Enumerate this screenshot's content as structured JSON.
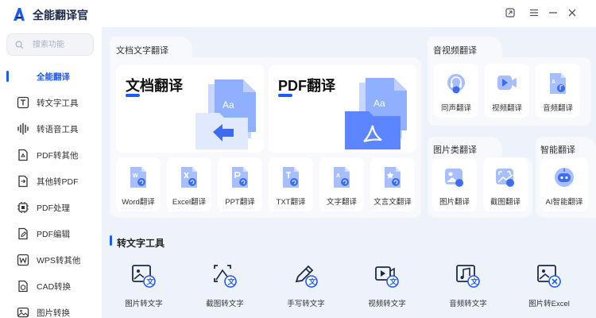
{
  "app": {
    "title": "全能翻译官"
  },
  "sidebar": {
    "search_placeholder": "搜索功能",
    "items": [
      {
        "label": "全能翻译",
        "active": true
      },
      {
        "label": "转文字工具"
      },
      {
        "label": "转语音工具"
      },
      {
        "label": "PDF转其他"
      },
      {
        "label": "其他转PDF"
      },
      {
        "label": "PDF处理"
      },
      {
        "label": "PDF编辑"
      },
      {
        "label": "WPS转其他"
      },
      {
        "label": "CAD转换"
      },
      {
        "label": "图片转换"
      }
    ]
  },
  "doc_section": {
    "title": "文档文字翻译",
    "big_cards": [
      {
        "label": "文档翻译"
      },
      {
        "label": "PDF翻译"
      }
    ],
    "cards": [
      {
        "label": "Word翻译"
      },
      {
        "label": "Excel翻译"
      },
      {
        "label": "PPT翻译"
      },
      {
        "label": "TXT翻译"
      },
      {
        "label": "文字翻译"
      },
      {
        "label": "文言文翻译"
      }
    ]
  },
  "av_section": {
    "title": "音视频翻译",
    "cards": [
      {
        "label": "同声翻译"
      },
      {
        "label": "视频翻译"
      },
      {
        "label": "音频翻译"
      }
    ]
  },
  "image_section": {
    "title": "图片类翻译",
    "cards": [
      {
        "label": "图片翻译"
      },
      {
        "label": "截图翻译"
      }
    ]
  },
  "ai_section": {
    "title": "智能翻译",
    "cards": [
      {
        "label": "AI智能翻译"
      }
    ]
  },
  "tools_section": {
    "title": "转文字工具",
    "items": [
      {
        "label": "图片转文字"
      },
      {
        "label": "截图转文字"
      },
      {
        "label": "手写转文字"
      },
      {
        "label": "视频转文字"
      },
      {
        "label": "音频转文字"
      },
      {
        "label": "图片转Excel"
      }
    ]
  },
  "colors": {
    "accent": "#1d5bff",
    "background": "#eef3fb",
    "panel": "#f7f9fd"
  }
}
